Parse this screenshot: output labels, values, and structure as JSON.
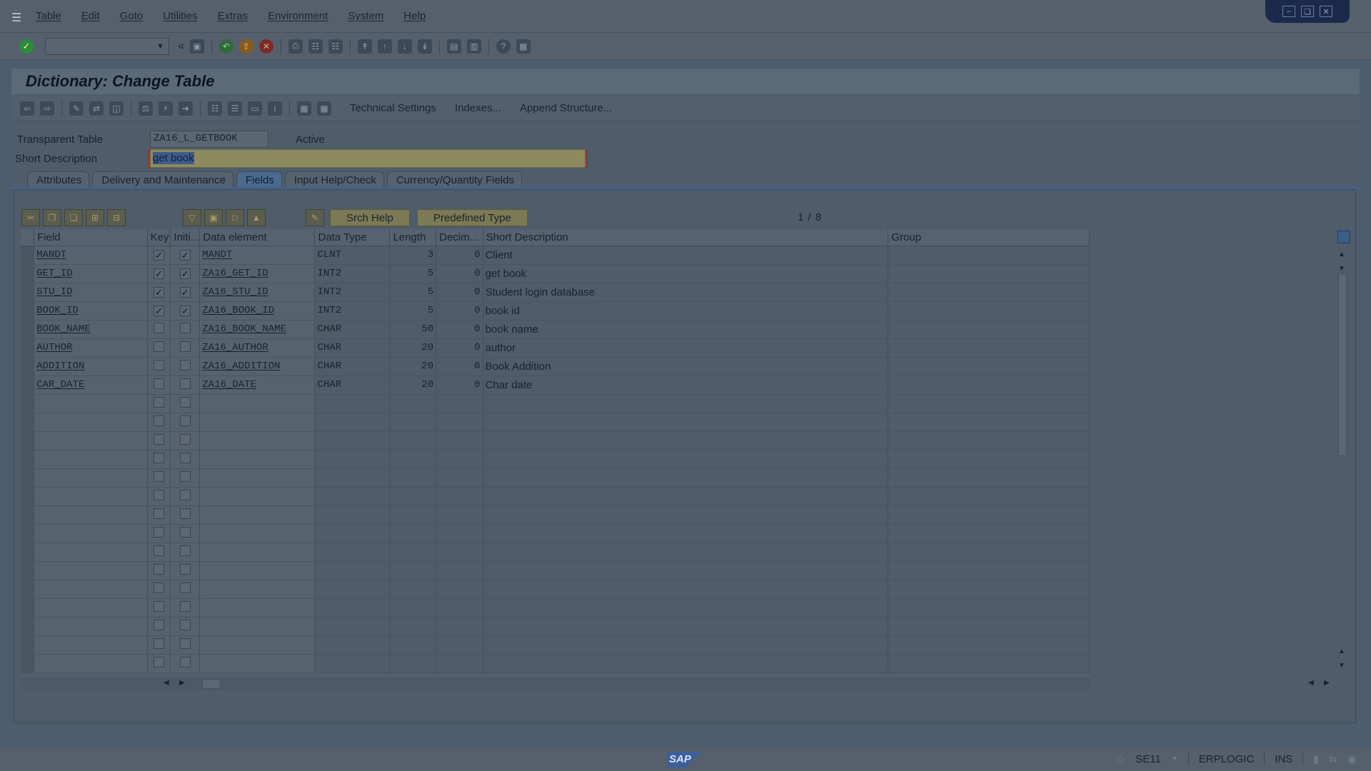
{
  "menu": [
    "Table",
    "Edit",
    "Goto",
    "Utilities",
    "Extras",
    "Environment",
    "System",
    "Help"
  ],
  "title": "Dictionary: Change Table",
  "app_toolbar_buttons": [
    "Technical Settings",
    "Indexes...",
    "Append Structure..."
  ],
  "header": {
    "table_label": "Transparent Table",
    "table_name": "ZA16_L_GETBOOK",
    "status": "Active",
    "desc_label": "Short Description",
    "desc_value": "get book"
  },
  "tabs": [
    "Attributes",
    "Delivery and Maintenance",
    "Fields",
    "Input Help/Check",
    "Currency/Quantity Fields"
  ],
  "active_tab": "Fields",
  "grid_buttons": {
    "search_help": "Srch Help",
    "predefined_type": "Predefined Type"
  },
  "pager": "1 / 8",
  "columns": [
    "Field",
    "Key",
    "Initi...",
    "Data element",
    "Data Type",
    "Length",
    "Decim...",
    "Short Description",
    "Group"
  ],
  "rows": [
    {
      "field": "MANDT",
      "key": true,
      "init": true,
      "element": "MANDT",
      "type": "CLNT",
      "length": "3",
      "dec": "0",
      "desc": "Client"
    },
    {
      "field": "GET_ID",
      "key": true,
      "init": true,
      "element": "ZA16_GET_ID",
      "type": "INT2",
      "length": "5",
      "dec": "0",
      "desc": "get book"
    },
    {
      "field": "STU_ID",
      "key": true,
      "init": true,
      "element": "ZA16_STU_ID",
      "type": "INT2",
      "length": "5",
      "dec": "0",
      "desc": "Student login database"
    },
    {
      "field": "BOOK_ID",
      "key": true,
      "init": true,
      "element": "ZA16_BOOK_ID",
      "type": "INT2",
      "length": "5",
      "dec": "0",
      "desc": "book id"
    },
    {
      "field": "BOOK_NAME",
      "key": false,
      "init": false,
      "element": "ZA16_BOOK_NAME",
      "type": "CHAR",
      "length": "50",
      "dec": "0",
      "desc": "book name"
    },
    {
      "field": "AUTHOR",
      "key": false,
      "init": false,
      "element": "ZA16_AUTHOR",
      "type": "CHAR",
      "length": "20",
      "dec": "0",
      "desc": "author"
    },
    {
      "field": "ADDITION",
      "key": false,
      "init": false,
      "element": "ZA16_ADDITION",
      "type": "CHAR",
      "length": "20",
      "dec": "0",
      "desc": "Book Addition"
    },
    {
      "field": "CAR_DATE",
      "key": false,
      "init": false,
      "element": "ZA16_DATE",
      "type": "CHAR",
      "length": "20",
      "dec": "0",
      "desc": "Char date"
    }
  ],
  "empty_rows": 15,
  "status_bar": {
    "logo": "SAP",
    "transaction": "SE11",
    "server": "ERPLOGIC",
    "mode": "INS"
  },
  "colors": {
    "overlay": "#000000",
    "active_tab": "#4b6a8e",
    "edit_field": "#8d8a5f"
  }
}
